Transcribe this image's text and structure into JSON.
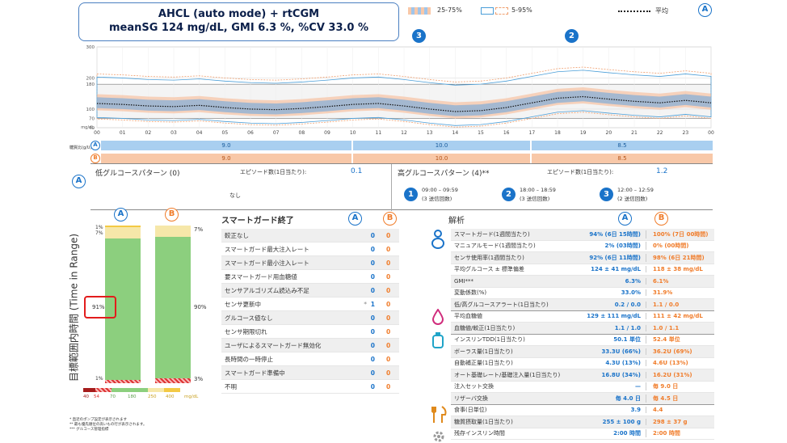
{
  "header": {
    "line1": "AHCL (auto mode) + rtCGM",
    "line2": "meanSG 124 mg/dL, GMI 6.3 %, %CV 33.0 %"
  },
  "legend": {
    "iqr": "25-75%",
    "range": "5-95%",
    "mean": "平均",
    "a": "A"
  },
  "markers": {
    "m3": "3",
    "m2": "2"
  },
  "chart": {
    "y_ticks": [
      "300",
      "200",
      "180",
      "100",
      "70",
      "40"
    ],
    "unit": "mg/dL",
    "x_ticks": [
      "00",
      "01",
      "02",
      "03",
      "04",
      "05",
      "06",
      "07",
      "08",
      "09",
      "10",
      "11",
      "12",
      "13",
      "14",
      "15",
      "16",
      "17",
      "18",
      "19",
      "20",
      "21",
      "22",
      "23",
      "00"
    ]
  },
  "chart_data": {
    "type": "line",
    "x": [
      0,
      1,
      2,
      3,
      4,
      5,
      6,
      7,
      8,
      9,
      10,
      11,
      12,
      13,
      14,
      15,
      16,
      17,
      18,
      19,
      20,
      21,
      22,
      23,
      24
    ],
    "series": [
      {
        "name": "平均",
        "values": [
          118,
          115,
          110,
          108,
          112,
          105,
          100,
          98,
          102,
          108,
          115,
          118,
          110,
          100,
          92,
          95,
          105,
          120,
          135,
          140,
          132,
          125,
          120,
          128,
          120
        ]
      }
    ],
    "ylim": [
      40,
      300
    ]
  },
  "basal": {
    "label": "糖質比(g/U)",
    "a_vals": [
      "9.0",
      "10.0",
      "8.5"
    ],
    "b_vals": [
      "9.0",
      "10.0",
      "8.5"
    ]
  },
  "low_pattern": {
    "title": "低グルコースパターン (0)",
    "episodes_label": "エピソード数(1日当たり):",
    "episodes": "0.1",
    "none": "なし"
  },
  "high_pattern": {
    "title": "高グルコースパターン (4)**",
    "episodes_label": "エピソード数(1日当たり):",
    "episodes": "1.2",
    "items": [
      {
        "n": "1",
        "time": "09:00 – 09:59",
        "count": "(3 送信回数)"
      },
      {
        "n": "2",
        "time": "18:00 – 18:59",
        "count": "(3 送信回数)"
      },
      {
        "n": "3",
        "time": "12:00 – 12:59",
        "count": "(2 送信回数)"
      }
    ]
  },
  "tir": {
    "ylabel": "目標範囲内時間 (Time in Range)",
    "a_top1": "1%",
    "a_top2": "7%",
    "a_main": "91%",
    "a_bottom": "1%",
    "b_top": "7%",
    "b_main": "90%",
    "b_bottom": "3%",
    "scale": [
      "40",
      "54",
      "70",
      "180",
      "250",
      "400",
      "mg/dL"
    ]
  },
  "footnotes": [
    "* 直近のポンプ設定が表示されます",
    "** 最も優先順位の高いもの行が表示されます。",
    "*** グルコース管理指標"
  ],
  "smartguard": {
    "title": "スマートガード終了",
    "rows": [
      {
        "label": "較正なし",
        "a": "0",
        "b": "0"
      },
      {
        "label": "スマートガード最大注入レート",
        "a": "0",
        "b": "0"
      },
      {
        "label": "スマートガード最小注入レート",
        "a": "0",
        "b": "0"
      },
      {
        "label": "要スマートガード用血糖値",
        "a": "0",
        "b": "0"
      },
      {
        "label": "センサアルゴリズム読込み不足",
        "a": "0",
        "b": "0"
      },
      {
        "label": "センサ更新中",
        "a": "1",
        "b": "0",
        "mark": "*"
      },
      {
        "label": "グルコース値なし",
        "a": "0",
        "b": "0"
      },
      {
        "label": "センサ期限切れ",
        "a": "0",
        "b": "0"
      },
      {
        "label": "ユーザによるスマートガード無効化",
        "a": "0",
        "b": "0"
      },
      {
        "label": "長時間の一時停止",
        "a": "0",
        "b": "0"
      },
      {
        "label": "スマートガード準備中",
        "a": "0",
        "b": "0"
      },
      {
        "label": "不明",
        "a": "0",
        "b": "0"
      }
    ]
  },
  "analysis": {
    "title": "解析",
    "rows": [
      {
        "label": "スマートガード(1週間当たり)",
        "a": "94% (6日 15時間)",
        "b": "100% (7日 00時間)"
      },
      {
        "label": "マニュアルモード(1週間当たり)",
        "a": "2% (03時間)",
        "b": "0% (00時間)"
      },
      {
        "label": "センサ使用率(1週間当たり)",
        "a": "92% (6日 11時間)",
        "b": "98% (6日 21時間)"
      },
      {
        "label": "平均グルコース ± 標準偏差",
        "a": "124 ± 41 mg/dL",
        "b": "118 ± 38 mg/dL"
      },
      {
        "label": "GMI***",
        "a": "6.3%",
        "b": "6.1%"
      },
      {
        "label": "変動係数(%)",
        "a": "33.0%",
        "b": "31.9%"
      },
      {
        "label": "低/高グルコースアラート(1日当たり)",
        "a": "0.2 / 0.0",
        "b": "1.1 / 0.0"
      },
      {
        "label": "平均血糖値",
        "a": "129 ± 111 mg/dL",
        "b": "111 ± 42 mg/dL"
      },
      {
        "label": "血糖値/較正(1日当たり)",
        "a": "1.1 / 1.0",
        "b": "1.0 / 1.1"
      },
      {
        "label": "インスリンTDD(1日当たり)",
        "a": "50.1 単位",
        "b": "52.4 単位"
      },
      {
        "label": "ボーラス量(1日当たり)",
        "a": "33.3U (66%)",
        "b": "36.2U (69%)"
      },
      {
        "label": "自動補正量(1日当たり)",
        "a": "4.3U (13%)",
        "b": "4.6U (13%)"
      },
      {
        "label": "オート基礎レート/基礎注入量(1日当たり)",
        "a": "16.8U (34%)",
        "b": "16.2U (31%)"
      },
      {
        "label": "注入セット交換",
        "a": "—",
        "b": "毎 9.0 日"
      },
      {
        "label": "リザーバ交換",
        "a": "毎 4.0 日",
        "b": "毎 4.5 日"
      },
      {
        "label": "食事(日単位)",
        "a": "3.9",
        "b": "4.4"
      },
      {
        "label": "糖質摂取量(1日当たり)",
        "a": "255 ± 100 g",
        "b": "298 ± 37 g"
      },
      {
        "label": "残存インスリン時間",
        "a": "2:00 時間",
        "b": "2:00 時間"
      }
    ]
  }
}
